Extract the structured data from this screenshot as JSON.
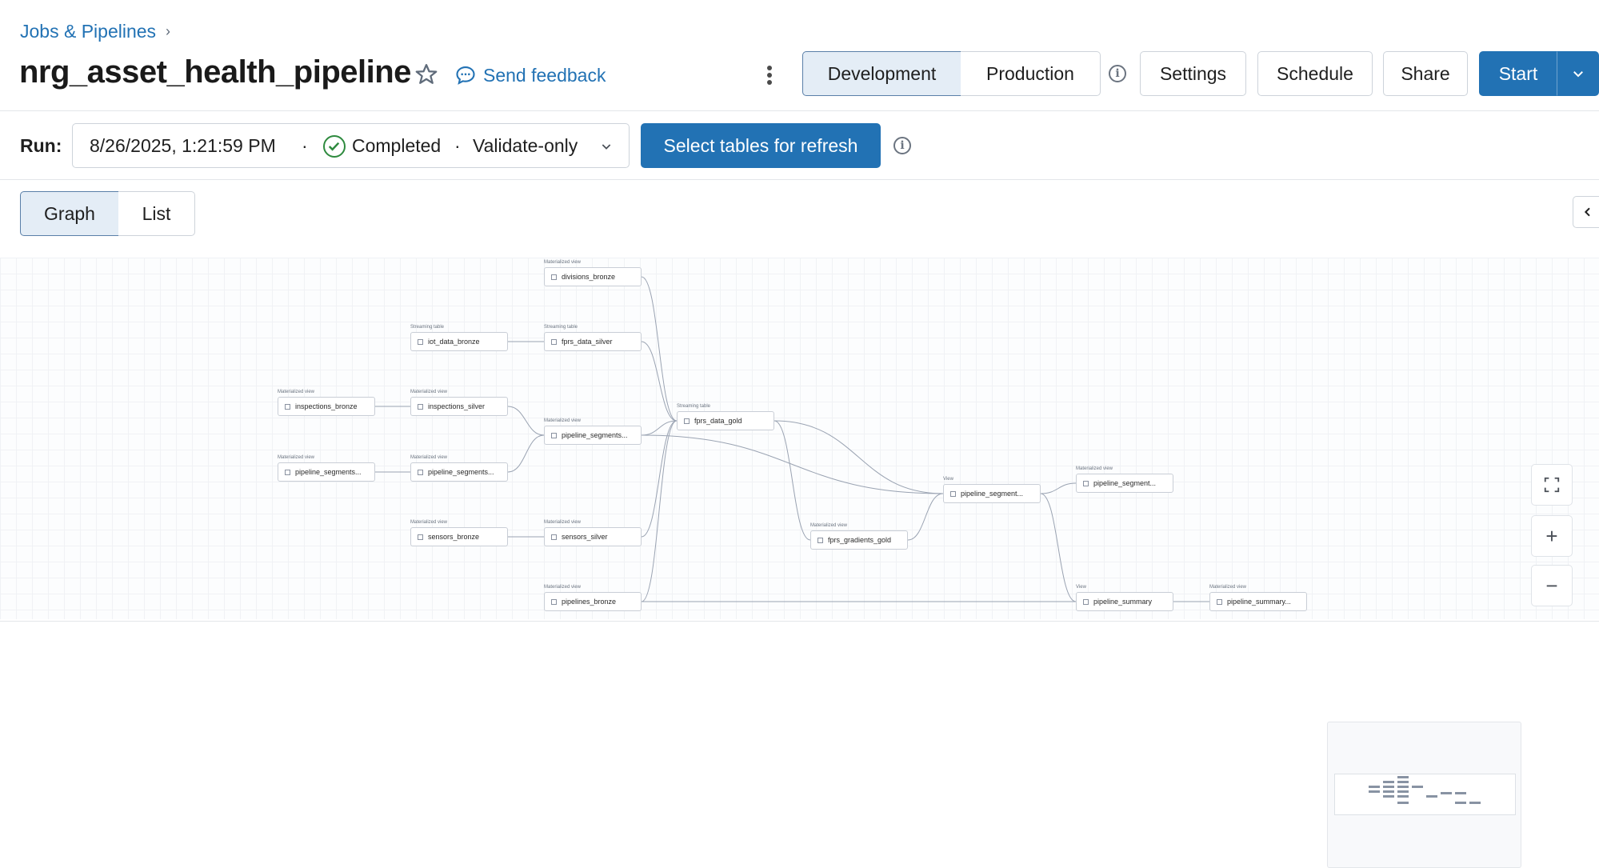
{
  "breadcrumb": {
    "label": "Jobs & Pipelines",
    "separator": "›"
  },
  "pipeline": {
    "name": "nrg_asset_health_pipeline"
  },
  "header": {
    "feedback_label": "Send feedback",
    "mode_development": "Development",
    "mode_production": "Production",
    "settings_label": "Settings",
    "schedule_label": "Schedule",
    "share_label": "Share",
    "start_label": "Start",
    "info_glyph": "i"
  },
  "run": {
    "label": "Run:",
    "timestamp": "8/26/2025, 1:21:59 PM",
    "separator": "·",
    "status": "Completed",
    "mode": "Validate-only",
    "refresh_button": "Select tables for refresh"
  },
  "view_toggle": {
    "graph": "Graph",
    "list": "List"
  },
  "graph": {
    "nodes": [
      {
        "id": "divisions_bronze",
        "type": "Materialized view",
        "label": "divisions_bronze"
      },
      {
        "id": "iot_data_bronze",
        "type": "Streaming table",
        "label": "iot_data_bronze"
      },
      {
        "id": "fprs_data_silver",
        "type": "Streaming table",
        "label": "fprs_data_silver"
      },
      {
        "id": "inspections_bronze",
        "type": "Materialized view",
        "label": "inspections_bronze"
      },
      {
        "id": "inspections_silver",
        "type": "Materialized view",
        "label": "inspections_silver"
      },
      {
        "id": "pipeline_segments_silver",
        "type": "Materialized view",
        "label": "pipeline_segments..."
      },
      {
        "id": "fprs_data_gold",
        "type": "Streaming table",
        "label": "fprs_data_gold"
      },
      {
        "id": "pipeline_segments_bronze",
        "type": "Materialized view",
        "label": "pipeline_segments..."
      },
      {
        "id": "pipeline_segments_raw",
        "type": "Materialized view",
        "label": "pipeline_segments..."
      },
      {
        "id": "pipeline_segment_view",
        "type": "View",
        "label": "pipeline_segment..."
      },
      {
        "id": "pipeline_segment_mv",
        "type": "Materialized view",
        "label": "pipeline_segment..."
      },
      {
        "id": "sensors_bronze",
        "type": "Materialized view",
        "label": "sensors_bronze"
      },
      {
        "id": "sensors_silver",
        "type": "Materialized view",
        "label": "sensors_silver"
      },
      {
        "id": "fprs_gradients_gold",
        "type": "Materialized view",
        "label": "fprs_gradients_gold"
      },
      {
        "id": "pipelines_bronze",
        "type": "Materialized view",
        "label": "pipelines_bronze"
      },
      {
        "id": "pipeline_summary",
        "type": "View",
        "label": "pipeline_summary"
      },
      {
        "id": "pipeline_summary_mv",
        "type": "Materialized view",
        "label": "pipeline_summary..."
      }
    ]
  },
  "controls": {
    "fit": "fit-view",
    "zoom_in": "+",
    "zoom_out": "−"
  },
  "colors": {
    "accent": "#2272b4",
    "success": "#2e8a3e",
    "edge": "#9aa3b2"
  }
}
